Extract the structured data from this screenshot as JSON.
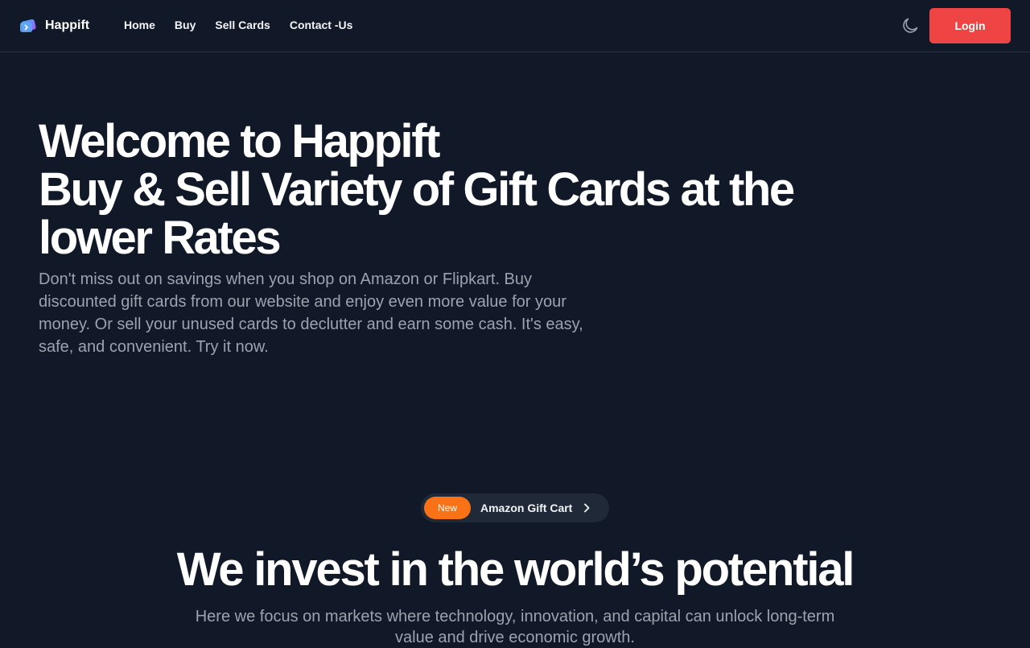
{
  "navbar": {
    "brand_name": "Happift",
    "links": [
      "Home",
      "Buy",
      "Sell Cards",
      "Contact -Us"
    ],
    "theme_toggle_icon": "moon-icon",
    "login_label": "Login",
    "login_color": "#ef4444"
  },
  "hero": {
    "title_line1": "Welcome to Happift",
    "title_line2": "Buy & Sell Variety of Gift Cards at the",
    "title_line3": "lower Rates",
    "description": "Don't miss out on savings when you shop on Amazon or Flipkart. Buy discounted gift cards from our website and enjoy even more value for your money. Or sell your unused cards to declutter and earn some cash. It's easy, safe, and convenient. Try it now."
  },
  "section": {
    "badge": "New",
    "badge_color": "#f97316",
    "announcement": "Amazon Gift Cart",
    "announcement_icon": "chevron-right-icon",
    "title": "We invest in the world’s potential",
    "description": "Here we focus on markets where technology, innovation, and capital can unlock long-term value and drive economic growth."
  },
  "colors": {
    "background": "#111827",
    "muted_text": "#9ca3af"
  }
}
